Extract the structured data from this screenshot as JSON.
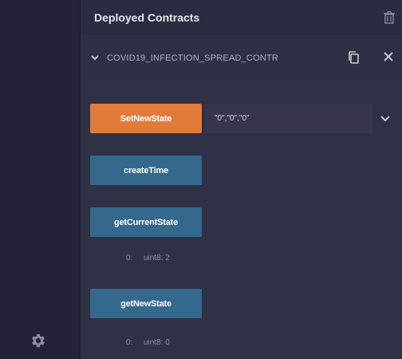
{
  "header": {
    "title": "Deployed Contracts"
  },
  "contract": {
    "name": "COVID19_INFECTION_SPREAD_CONTR"
  },
  "functions": [
    {
      "label": "SetNewState",
      "input_value": "\"0\",\"0\",\"0\"",
      "color": "#e07b39"
    },
    {
      "label": "createTime",
      "color": "#34688c"
    },
    {
      "label": "getCurrentState",
      "color": "#34688c",
      "output_index": "0:",
      "output_value": "uint8: 2"
    },
    {
      "label": "getNewState",
      "color": "#34688c",
      "output_index": "0:",
      "output_value": "uint8: 0"
    }
  ],
  "icons": {
    "settings": "gear-icon",
    "trash": "trash-icon",
    "expand": "chevron-down-icon",
    "copy": "copy-icon",
    "close": "close-icon",
    "dropdown": "chevron-down-icon"
  }
}
